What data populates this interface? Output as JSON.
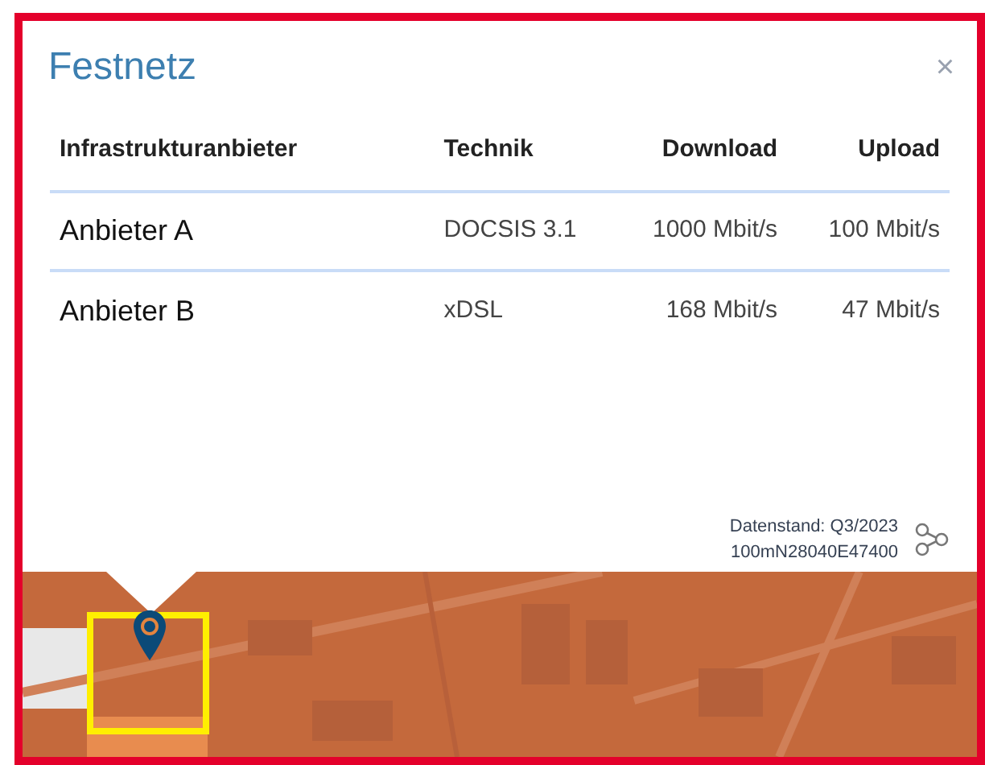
{
  "dialog": {
    "title": "Festnetz",
    "close": "×"
  },
  "table": {
    "columns": [
      "Infrastrukturanbieter",
      "Technik",
      "Download",
      "Upload"
    ],
    "rows": [
      [
        "Anbieter A",
        "DOCSIS 3.1",
        "1000 Mbit/s",
        "100 Mbit/s"
      ],
      [
        "Anbieter B",
        "xDSL",
        "168 Mbit/s",
        "47 Mbit/s"
      ]
    ]
  },
  "footer": {
    "data_date": "Datenstand: Q3/2023",
    "cell_id": "100mN28040E47400"
  }
}
